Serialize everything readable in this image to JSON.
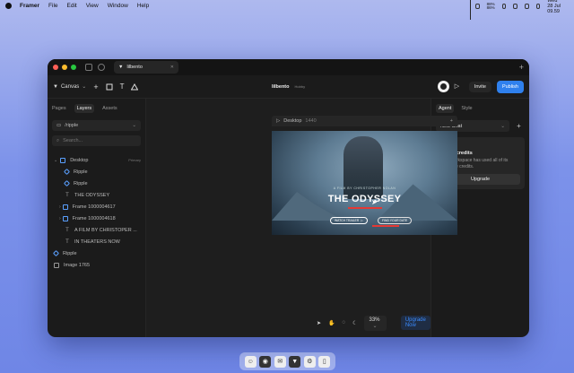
{
  "menubar": {
    "app": "Framer",
    "items": [
      "File",
      "Edit",
      "View",
      "Window",
      "Help"
    ],
    "battery": "88%\n86%",
    "datetime": "Wed 28 Jul 09.59"
  },
  "window": {
    "tab_title": "lilbento",
    "toolbar": {
      "canvas_label": "Canvas",
      "project": "lilbento",
      "version": "Hobby",
      "invite": "Invite",
      "publish": "Publish"
    }
  },
  "left_panel": {
    "tabs": [
      "Pages",
      "Layers",
      "Assets"
    ],
    "active_tab": "Layers",
    "component_select": "/ripple",
    "search_placeholder": "Search...",
    "layers": [
      {
        "label": "Desktop",
        "badge": "Primary",
        "icon": "frame-icon"
      },
      {
        "label": "Ripple",
        "icon": "component-icon"
      },
      {
        "label": "Ripple",
        "icon": "component-icon"
      },
      {
        "label": "THE ODYSSEY",
        "icon": "text-icon"
      },
      {
        "label": "Frame 1000004617",
        "icon": "frame-icon"
      },
      {
        "label": "Frame 1000004618",
        "icon": "frame-icon"
      },
      {
        "label": "A FILM BY CHRISTOPER ...",
        "icon": "text-icon"
      },
      {
        "label": "IN THEATERS NOW",
        "icon": "text-icon"
      },
      {
        "label": "Ripple",
        "icon": "component-icon"
      },
      {
        "label": "Image 1765",
        "icon": "image-icon"
      }
    ]
  },
  "canvas": {
    "frame_name": "Desktop",
    "frame_size": "1440",
    "hero": {
      "film_by": "A FILM BY CHRISTOPHER NOLAN",
      "title": "THE ODYSSEY",
      "button1": "WATCH TRAILER",
      "button2": "FIND YOUR DATE"
    },
    "zoom": "33%",
    "upgrade": "Upgrade Now"
  },
  "right_panel": {
    "tabs": [
      "Agent",
      "Style"
    ],
    "active_tab": "Agent",
    "chat_select": "New Chat",
    "credits_title": "Out of credits",
    "credits_text": "Your workspace has used all of its available credits.",
    "upgrade_button": "Upgrade"
  },
  "colors": {
    "accent": "#2f80ed",
    "background": "#1b1b1b",
    "desktop": "#7c92ea"
  }
}
